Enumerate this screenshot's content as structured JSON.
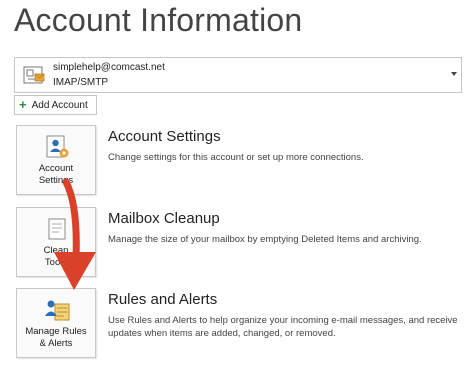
{
  "page": {
    "title": "Account Information"
  },
  "account": {
    "email": "simplehelp@comcast.net",
    "type": "IMAP/SMTP",
    "icon": "account-mail-icon"
  },
  "add_account": {
    "label": "Add Account",
    "icon": "plus-icon"
  },
  "sections": [
    {
      "tile_label": "Account\nSettings",
      "icon": "account-settings-icon",
      "heading": "Account Settings",
      "description": "Change settings for this account or set up more connections."
    },
    {
      "tile_label": "Clean\nTools",
      "icon": "cleanup-tools-icon",
      "heading": "Mailbox Cleanup",
      "description": "Manage the size of your mailbox by emptying Deleted Items and archiving."
    },
    {
      "tile_label": "Manage Rules\n& Alerts",
      "icon": "rules-alerts-icon",
      "heading": "Rules and Alerts",
      "description": "Use Rules and Alerts to help organize your incoming e-mail messages, and receive updates when items are added, changed, or removed."
    }
  ],
  "colors": {
    "accent": "#d9412b",
    "text": "#444444",
    "border": "#c6c6c6",
    "icon_blue": "#2b6fb6",
    "icon_orange": "#e8a23a"
  }
}
